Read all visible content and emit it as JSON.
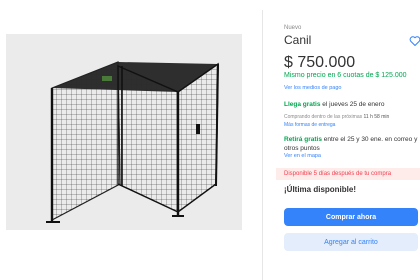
{
  "product": {
    "condition": "Nuevo",
    "title": "Canil",
    "price": "$ 750.000",
    "installments": "Mismo precio en 6 cuotas de $ 125.000",
    "payment_methods_link": "Ver los medios de pago",
    "image_icon": "dog-kennel-image"
  },
  "shipping": {
    "highlight": "Llega gratis",
    "date_text": " el jueves 25 de enero",
    "deadline_prefix": "Comprando dentro de las próximas ",
    "deadline_time": "11 h 58 min",
    "more_link": "Más formas de entrega"
  },
  "pickup": {
    "highlight": "Retirá gratis",
    "text": " entre el 25 y 30 ene. en correo y otros puntos",
    "map_link": "Ver en el mapa"
  },
  "availability": {
    "banner": "Disponible 5 días después de tu compra",
    "stock": "¡Última disponible!"
  },
  "actions": {
    "buy_now": "Comprar ahora",
    "add_to_cart": "Agregar al carrito"
  },
  "icons": {
    "favorite": "heart-outline-icon"
  },
  "colors": {
    "accent": "#3483fa",
    "green": "#00a650",
    "alert": "#f23d4f"
  }
}
